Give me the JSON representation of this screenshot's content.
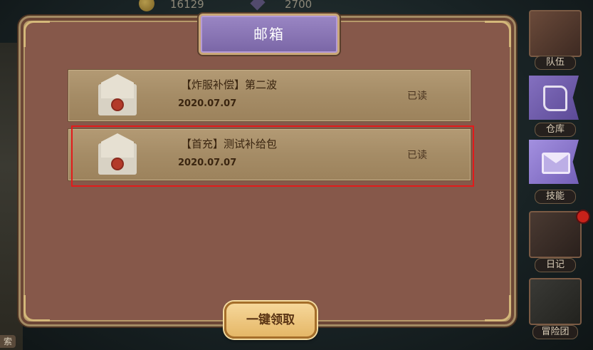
{
  "resources": {
    "coin_value": "16129",
    "gem_value": "2700"
  },
  "left_edge_label": "索",
  "mailbox": {
    "title": "邮箱",
    "mails": [
      {
        "title": "【炸服补偿】第二波",
        "date": "2020.07.07",
        "status": "已读",
        "selected": false
      },
      {
        "title": "【首充】测试补给包",
        "date": "2020.07.07",
        "status": "已读",
        "selected": true
      }
    ],
    "claim_all_label": "一键领取"
  },
  "side_menu": {
    "items": [
      {
        "label": "队伍",
        "icon": "book-icon"
      },
      {
        "label": "仓库",
        "icon": "scroll-icon"
      },
      {
        "label": "技能",
        "icon": "mail-icon",
        "active": true
      },
      {
        "label": "日记",
        "icon": "diary-icon",
        "badge": true
      },
      {
        "label": "冒险团",
        "icon": "adventure-icon"
      }
    ]
  },
  "colors": {
    "panel_bg": "#86584a",
    "title_plate": "#8a76b6",
    "selection_outline": "#e21b1b",
    "claim_button": "#ecc47a"
  }
}
